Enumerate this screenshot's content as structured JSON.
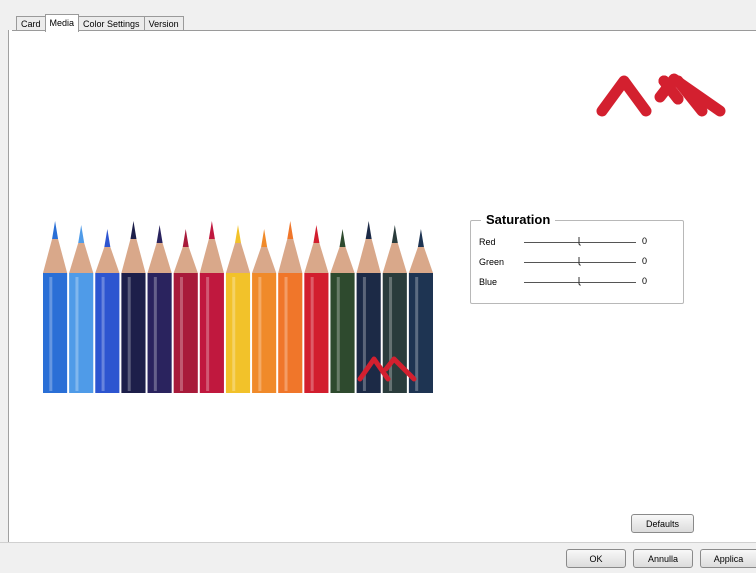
{
  "tabs": [
    {
      "label": "Card",
      "active": false
    },
    {
      "label": "Media",
      "active": true
    },
    {
      "label": "Color Settings",
      "active": false
    },
    {
      "label": "Version",
      "active": false
    }
  ],
  "brand_color": "#d3202f",
  "image": {
    "subject": "colored-pencils",
    "pencil_colors": [
      "#2a6fd6",
      "#4f9be8",
      "#2d55d0",
      "#1d1f4a",
      "#2a235e",
      "#a81a3a",
      "#c0183e",
      "#f2c22a",
      "#f08a2a",
      "#f0762a",
      "#d21e2e",
      "#2e4a2e",
      "#1c2a46",
      "#2a3c3c",
      "#1e3452"
    ],
    "overlay_logo": "m-logo"
  },
  "saturation": {
    "title": "Saturation",
    "channels": [
      {
        "label": "Red",
        "value": "0",
        "level": 0
      },
      {
        "label": "Green",
        "value": "0",
        "level": 0
      },
      {
        "label": "Blue",
        "value": "0",
        "level": 0
      }
    ]
  },
  "buttons": {
    "defaults": "Defaults",
    "ok": "OK",
    "cancel": "Annulla",
    "apply": "Applica"
  }
}
